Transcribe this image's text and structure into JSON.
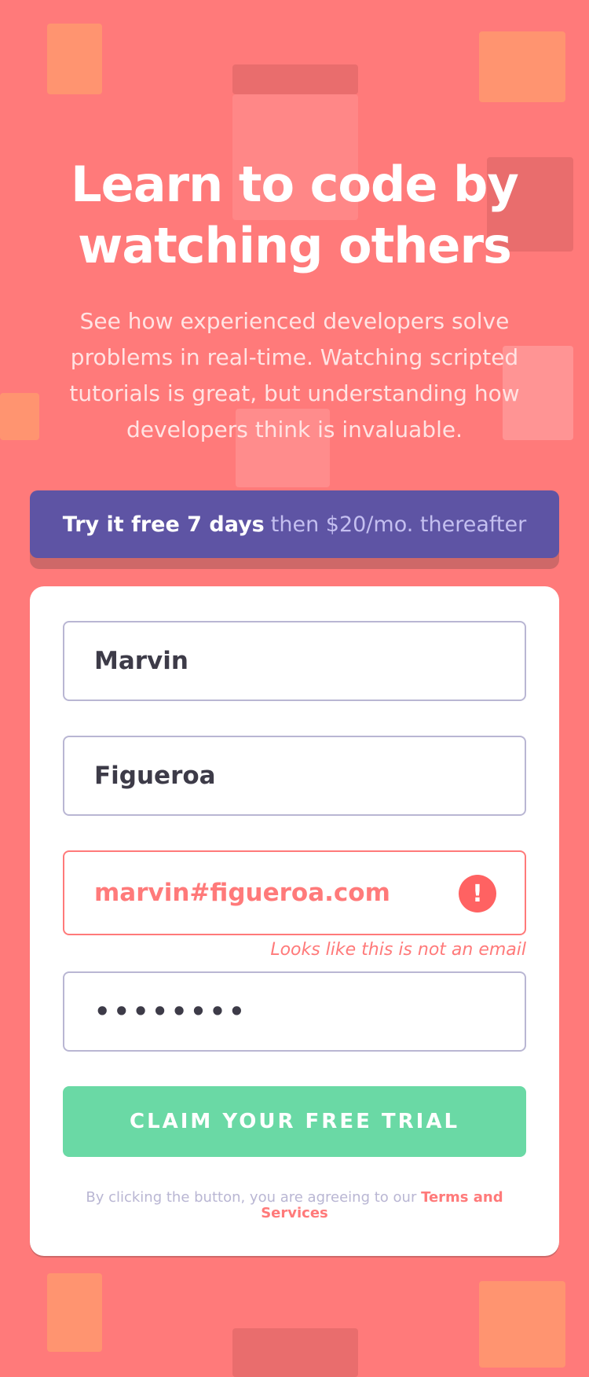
{
  "hero": {
    "title": "Learn to code by watching others",
    "description": "See how experienced developers solve problems in real-time. Watching scripted tutorials is great, but understanding how developers think is invaluable."
  },
  "promo": {
    "strong_text": "Try it free 7 days",
    "rest_text": "then $20/mo. thereafter"
  },
  "form": {
    "first_name": {
      "value": "Marvin"
    },
    "last_name": {
      "value": "Figueroa"
    },
    "email": {
      "value": "marvin#figueroa.com",
      "error_message": "Looks like this is not an email",
      "error_icon": "!"
    },
    "password": {
      "masked_value": "••••••••"
    },
    "submit_label": "CLAIM YOUR FREE TRIAL",
    "terms_text": "By clicking the button, you are agreeing to our",
    "terms_link": "Terms and Services"
  },
  "colors": {
    "background": "#ff7a7a",
    "promo": "#5e54a4",
    "accent_green": "#6ad9a5",
    "error": "#ff7a7a"
  }
}
